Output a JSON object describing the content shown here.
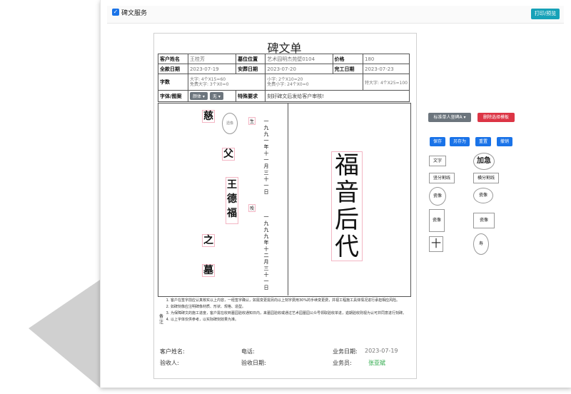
{
  "header": {
    "checkbox_label": "碑文服务",
    "print_label": "打印/预览"
  },
  "sheet": {
    "title": "碑文单",
    "labels": {
      "customer": "客户姓名",
      "location": "墓位位置",
      "price": "价格",
      "deposit": "全款日期",
      "burial": "安葬日期",
      "complete": "完工日期",
      "chars": "字数",
      "font": "字体/图案",
      "special": "特殊要求"
    },
    "values": {
      "customer": "王桂芳",
      "location": "艺术园明杰苑壁0104",
      "price": "180",
      "deposit": "2023-07-19",
      "burial": "2023-07-20",
      "complete": "2023-07-23",
      "special": "刻好碑文后发给客户审核!"
    },
    "chars": {
      "big": "大字: 4个X15=60",
      "big_free": "免费大字: 3个X0=0",
      "small": "小字: 2个X10=20",
      "small_free": "免费小字: 24个X0=0",
      "extra": "特大字: 4个X25=100"
    },
    "font_select": "颜体",
    "pattern_select": "无",
    "left_chars": [
      "慈",
      "父",
      "王",
      "德",
      "福",
      "之",
      "墓"
    ],
    "circle_text": "遗像",
    "tag_sheng": "生",
    "tag_shi": "殁",
    "date_birth": [
      "一",
      "九",
      "九",
      "一",
      "年",
      "十",
      "一",
      "月",
      "三",
      "十",
      "一",
      "日"
    ],
    "date_death": [
      "一",
      "九",
      "九",
      "九",
      "年",
      "十",
      "二",
      "月",
      "三",
      "十",
      "一",
      "日"
    ],
    "big_text": [
      "福",
      "音",
      "后",
      "代"
    ],
    "notes_mark": "备注",
    "notes": [
      "客户在签字前应认真核实以上内容，一经签字确认，如需变更需另向以上刻字费用30%的手续变更费，并视工程施工具体情况进行承担相应风险。",
      "如碑刻像应注明碑像材质、形状、规格、造型。",
      "为保障碑文的施工进度，客户需在收到墓园验收通知日内，来墓园验收或通过艺术园墓园公众号领取验收单进，逾期验收则视为认可并同意进行刻碑。",
      "以上字体仅供参考，以实际碑刻效果为准。"
    ],
    "footer": {
      "cust_sign": "客户姓名:",
      "phone": "电话:",
      "biz_date": "业务日期:",
      "biz_date_val": "2023-07-19",
      "inspector": "验收人:",
      "inspect_date": "验收日期:",
      "salesman": "业务员:",
      "salesman_val": "张亚斌"
    }
  },
  "tools": {
    "template_select": "标准单人竖碑A",
    "delete_template": "删除选择模板",
    "save": "保存",
    "save_as": "另存为",
    "reset": "重置",
    "undo": "撤销",
    "text": "文字",
    "urgent": "加急",
    "vdivider": "竖分割线",
    "hdivider": "横分割线",
    "portrait1": "瓷像",
    "portrait2": "瓷像",
    "portrait3": "瓷像",
    "portrait4": "瓷像",
    "cross": "十",
    "longevity": "寿"
  },
  "colors": {
    "primary": "#1a73e8",
    "info": "#17a2b8",
    "danger": "#dc3545",
    "secondary": "#6c757d",
    "success": "#28a745"
  }
}
